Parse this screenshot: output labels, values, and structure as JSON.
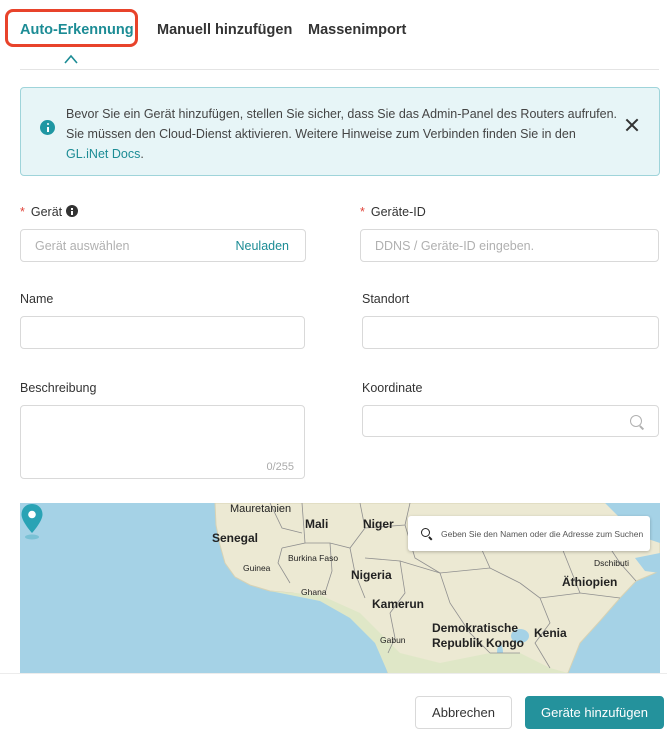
{
  "tabs": {
    "items": [
      {
        "label": "Auto-Erkennung",
        "active": true
      },
      {
        "label": "Manuell hinzufügen",
        "active": false
      },
      {
        "label": "Massenimport",
        "active": false
      }
    ]
  },
  "alert": {
    "text_1": "Bevor Sie ein Gerät hinzufügen, stellen Sie sicher, dass Sie das Admin-Panel des Routers aufrufen.",
    "text_2": "Sie müssen den Cloud-Dienst aktivieren. Weitere Hinweise zum Verbinden finden Sie in den",
    "link": "GL.iNet Docs",
    "link_suffix": ".",
    "icon": "info-icon",
    "close_icon": "close-icon"
  },
  "form": {
    "device": {
      "required_mark": "*",
      "label": "Gerät",
      "placeholder": "Gerät auswählen",
      "action": "Neuladen"
    },
    "device_id": {
      "required_mark": "*",
      "label": "Geräte-ID",
      "placeholder": "DDNS / Geräte-ID eingeben."
    },
    "name": {
      "label": "Name",
      "value": ""
    },
    "location": {
      "label": "Standort",
      "value": ""
    },
    "description": {
      "label": "Beschreibung",
      "value": "",
      "counter": "0/255"
    },
    "coordinate": {
      "label": "Koordinate",
      "value": ""
    }
  },
  "map": {
    "search_placeholder": "Geben Sie den Namen oder die Adresse zum Suchen ein",
    "labels": {
      "mauretanien": "Mauretanien",
      "mali": "Mali",
      "niger": "Niger",
      "senegal": "Senegal",
      "burkina_faso": "Burkina Faso",
      "guinea": "Guinea",
      "nigeria": "Nigeria",
      "ghana": "Ghana",
      "kamerun": "Kamerun",
      "gabun": "Gabun",
      "kongo_1": "Demokratische",
      "kongo_2": "Republik Kongo",
      "kenia": "Kenia",
      "aethiopien": "Äthiopien",
      "dschibuti": "Dschibuti"
    },
    "colors": {
      "water": "#a5d2e6",
      "land": "#ece9d3",
      "border": "#8f8f8f",
      "pin": "#2aa3b5"
    }
  },
  "footer": {
    "cancel": "Abbrechen",
    "submit": "Geräte hinzufügen"
  },
  "colors": {
    "accent": "#1c8c95",
    "primary_button": "#24929c",
    "highlight": "#e8432b",
    "required": "#e0443a"
  }
}
